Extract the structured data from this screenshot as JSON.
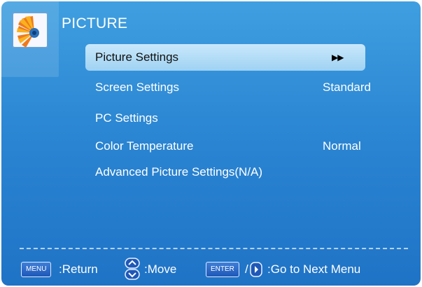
{
  "header": {
    "title": "PICTURE",
    "icon": "flower-picture-icon"
  },
  "menu": {
    "items": [
      {
        "label": "Picture Settings",
        "value": "",
        "selected": true,
        "indicator": "▶▶"
      },
      {
        "label": "Screen Settings",
        "value": "Standard"
      },
      {
        "label": "PC Settings",
        "value": ""
      },
      {
        "label": "Color Temperature",
        "value": "Normal"
      },
      {
        "label": "Advanced Picture Settings(N/A)",
        "value": ""
      }
    ]
  },
  "footer": {
    "menu_key": "MENU",
    "return_text": ":Return",
    "move_text": ":Move",
    "enter_key": "ENTER",
    "slash": "/",
    "next_text": ":Go to Next Menu"
  },
  "colors": {
    "panel_top": "#3f9fe0",
    "panel_bottom": "#1f73c6",
    "selected_highlight": "#b9def7",
    "text": "#ffffff"
  }
}
